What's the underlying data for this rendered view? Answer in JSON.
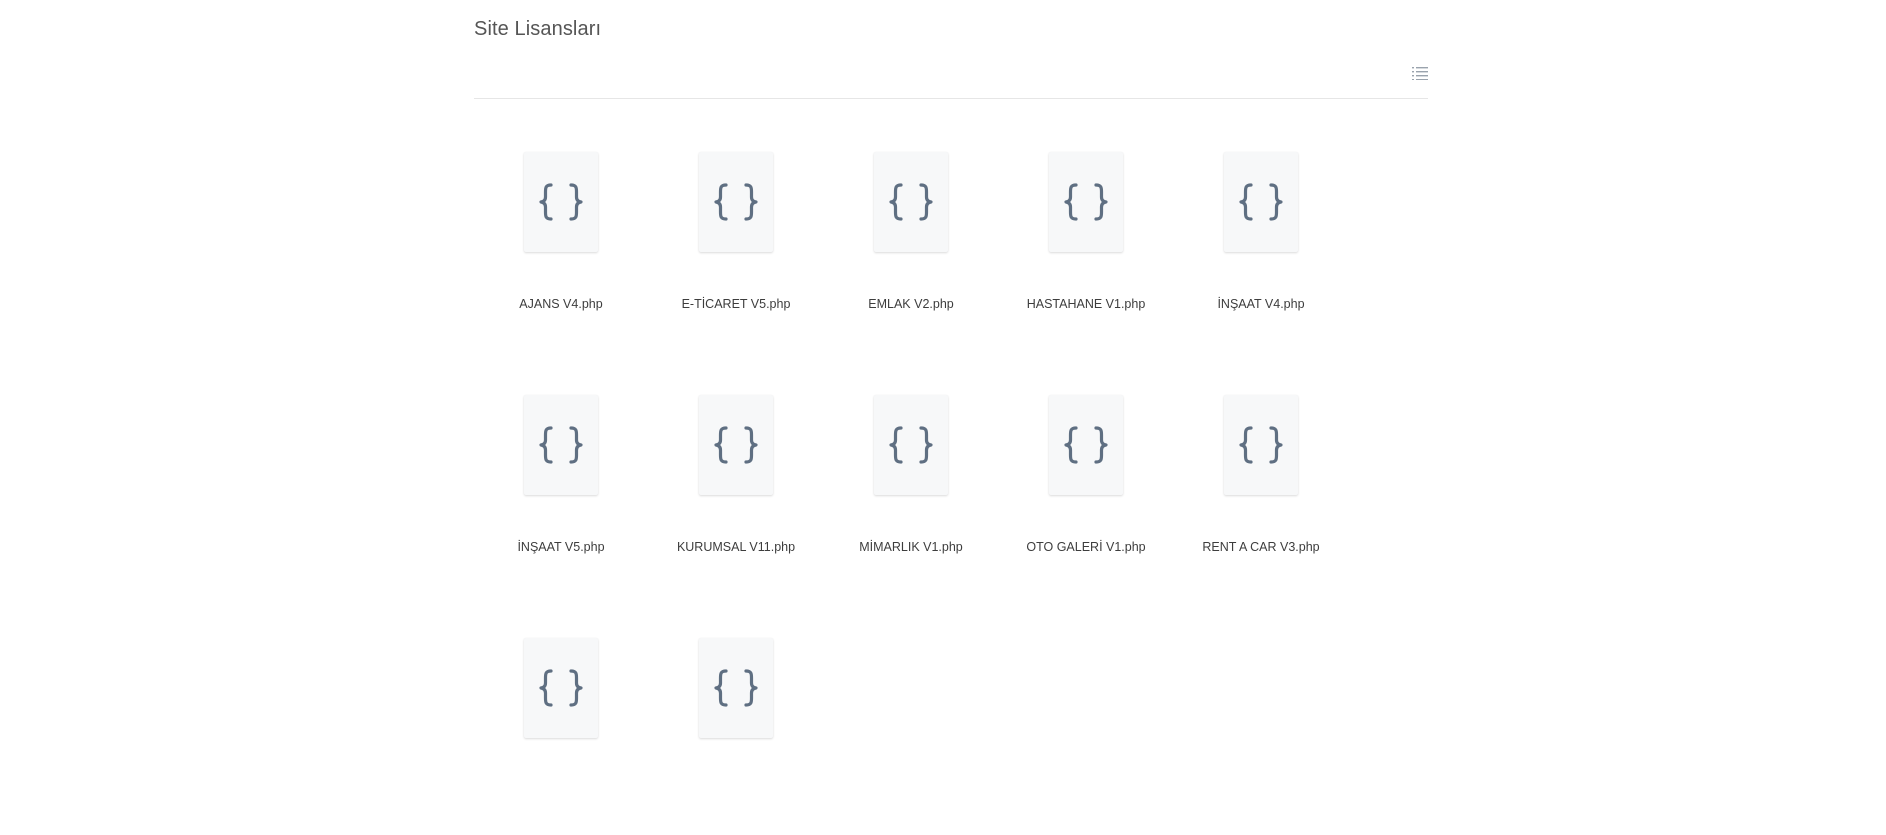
{
  "page": {
    "title": "Site Lisansları"
  },
  "toolbar": {
    "view_toggle_icon": "list-view-icon"
  },
  "file_icon": "code-braces-icon",
  "colors": {
    "icon_color": "#5f6f82",
    "thumb_bg": "#f7f8f9",
    "divider": "#e6e6e6"
  },
  "files": [
    {
      "name": "AJANS V4.php"
    },
    {
      "name": "E-TİCARET V5.php"
    },
    {
      "name": "EMLAK V2.php"
    },
    {
      "name": "HASTAHANE V1.php"
    },
    {
      "name": "İNŞAAT V4.php"
    },
    {
      "name": "İNŞAAT V5.php"
    },
    {
      "name": "KURUMSAL V11.php"
    },
    {
      "name": "MİMARLIK V1.php"
    },
    {
      "name": "OTO GALERİ V1.php"
    },
    {
      "name": "RENT A CAR V3.php"
    },
    {
      "name": ""
    },
    {
      "name": ""
    }
  ]
}
